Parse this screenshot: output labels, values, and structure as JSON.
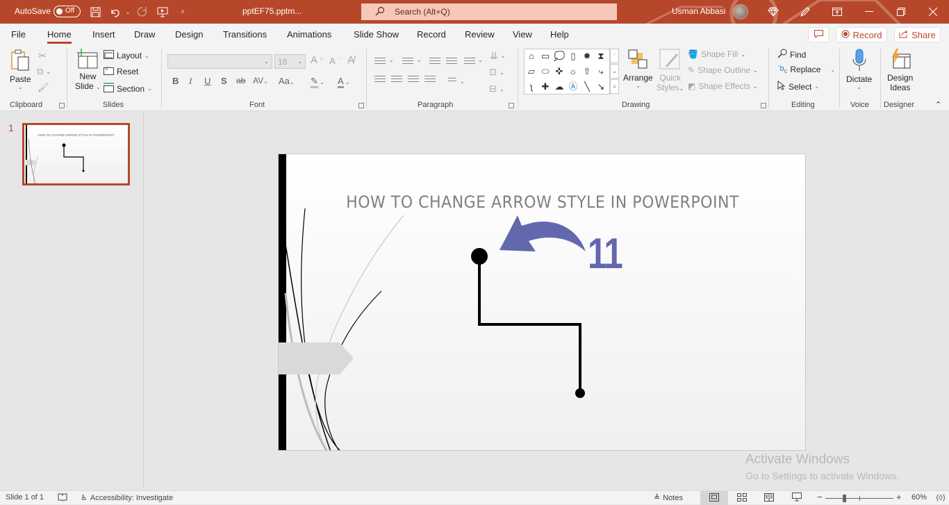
{
  "titlebar": {
    "autosave_label": "AutoSave",
    "autosave_state": "Off",
    "filename": "pptEF75.pptm...",
    "search_placeholder": "Search (Alt+Q)",
    "user_name": "Usman Abbasi",
    "icons": [
      "save-icon",
      "undo-icon",
      "redo-icon",
      "present-icon",
      "customize-qat-icon",
      "diamond-icon",
      "pen-icon",
      "ribbon-display-icon",
      "minimize-icon",
      "restore-icon",
      "close-icon"
    ]
  },
  "tabs": [
    {
      "label": "File",
      "active": false
    },
    {
      "label": "Home",
      "active": true
    },
    {
      "label": "Insert",
      "active": false
    },
    {
      "label": "Draw",
      "active": false
    },
    {
      "label": "Design",
      "active": false
    },
    {
      "label": "Transitions",
      "active": false
    },
    {
      "label": "Animations",
      "active": false
    },
    {
      "label": "Slide Show",
      "active": false
    },
    {
      "label": "Record",
      "active": false
    },
    {
      "label": "Review",
      "active": false
    },
    {
      "label": "View",
      "active": false
    },
    {
      "label": "Help",
      "active": false
    }
  ],
  "top_actions": {
    "record_label": "Record",
    "share_label": "Share"
  },
  "ribbon": {
    "clipboard": {
      "label": "Clipboard",
      "paste": "Paste"
    },
    "slides": {
      "label": "Slides",
      "new_slide_1": "New",
      "new_slide_2": "Slide",
      "layout": "Layout",
      "reset": "Reset",
      "section": "Section"
    },
    "font": {
      "label": "Font",
      "font_name": "",
      "font_size": "18",
      "bold": "B",
      "italic": "I",
      "underline": "U",
      "shadow": "S",
      "strike": "ab",
      "spacing": "AV",
      "case": "Aa"
    },
    "paragraph": {
      "label": "Paragraph"
    },
    "drawing": {
      "label": "Drawing",
      "arrange": "Arrange",
      "quick_styles_1": "Quick",
      "quick_styles_2": "Styles",
      "shape_fill": "Shape Fill",
      "shape_outline": "Shape Outline",
      "shape_effects": "Shape Effects"
    },
    "editing": {
      "label": "Editing",
      "find": "Find",
      "replace": "Replace",
      "select": "Select"
    },
    "voice": {
      "label": "Voice",
      "dictate": "Dictate"
    },
    "designer": {
      "label": "Designer",
      "design_ideas_1": "Design",
      "design_ideas_2": "Ideas"
    }
  },
  "thumbnails": [
    {
      "number": "1",
      "title": "HOW TO CHANGE ARROW STYLE IN POWERPOINT",
      "selected": true
    }
  ],
  "slide": {
    "title": "HOW TO CHANGE ARROW STYLE IN POWERPOINT",
    "step_number": "11",
    "accent_color": "#6367ad"
  },
  "watermark": {
    "line1": "Activate Windows",
    "line2": "Go to Settings to activate Windows."
  },
  "statusbar": {
    "slide_info": "Slide 1 of 1",
    "accessibility": "Accessibility: Investigate",
    "notes": "Notes",
    "zoom": "60%",
    "zoom_fraction": 0.6
  },
  "colors": {
    "brand": "#b7472a",
    "search_bg": "#f6c8b8"
  }
}
